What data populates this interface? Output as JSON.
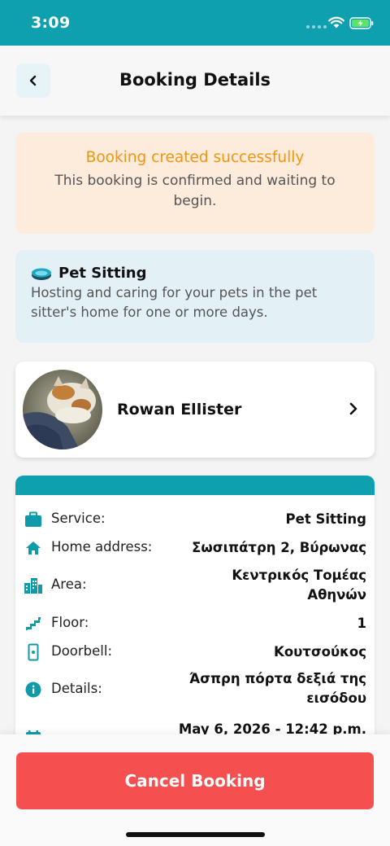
{
  "status_bar": {
    "time": "3:09"
  },
  "header": {
    "title": "Booking Details"
  },
  "alert": {
    "title": "Booking created successfully",
    "text": "This booking is confirmed and waiting to begin."
  },
  "service": {
    "title": "Pet Sitting",
    "description": "Hosting and caring for your pets in the pet sitter's home for one or more days."
  },
  "sitter": {
    "name": "Rowan Ellister"
  },
  "details": {
    "rows": [
      {
        "icon": "briefcase-icon",
        "label": "Service:",
        "value": "Pet Sitting"
      },
      {
        "icon": "home-icon",
        "label": "Home address:",
        "value": "Σωσιπάτρη 2, Βύρωνας"
      },
      {
        "icon": "city-icon",
        "label": "Area:",
        "value": "Κεντρικός Τομέας Αθηνών"
      },
      {
        "icon": "stairs-icon",
        "label": "Floor:",
        "value": "1"
      },
      {
        "icon": "doorbell-icon",
        "label": "Doorbell:",
        "value": "Κουτσούκος"
      },
      {
        "icon": "info-icon",
        "label": "Details:",
        "value": "Άσπρη πόρτα δεξιά της εισόδου"
      },
      {
        "icon": "calendar-icon",
        "label": "",
        "value": "May 6, 2026 - 12:42 p.m."
      }
    ]
  },
  "actions": {
    "cancel_label": "Cancel Booking"
  },
  "colors": {
    "accent": "#0fa0b0",
    "danger": "#f5504f",
    "warning": "#f3950e"
  }
}
